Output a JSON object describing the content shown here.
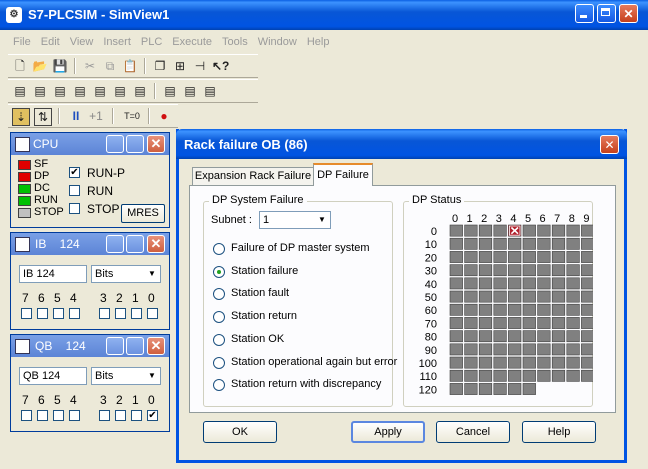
{
  "app": {
    "title": "S7-PLCSIM - SimView1",
    "menu": [
      "File",
      "Edit",
      "View",
      "Insert",
      "PLC",
      "Execute",
      "Tools",
      "Window",
      "Help"
    ],
    "toolbar3": {
      "pause": "II",
      "step": "+1",
      "timer_reset": "T=0"
    }
  },
  "cpu": {
    "title": "CPU",
    "leds": [
      {
        "label": "SF",
        "color": "#e00000"
      },
      {
        "label": "DP",
        "color": "#e00000"
      },
      {
        "label": "DC",
        "color": "#00c000"
      },
      {
        "label": "RUN",
        "color": "#00c000"
      },
      {
        "label": "STOP",
        "color": "#c0c0c0"
      }
    ],
    "modes": [
      {
        "label": "RUN-P",
        "checked": true
      },
      {
        "label": "RUN",
        "checked": false
      },
      {
        "label": "STOP",
        "checked": false
      }
    ],
    "mres_label": "MRES"
  },
  "ib": {
    "title": "IB    124",
    "address": "IB  124",
    "format": "Bits",
    "bit_labels": [
      "7",
      "6",
      "5",
      "4",
      "3",
      "2",
      "1",
      "0"
    ],
    "bits": [
      false,
      false,
      false,
      false,
      false,
      false,
      false,
      false
    ]
  },
  "qb": {
    "title": "QB    124",
    "address": "QB  124",
    "format": "Bits",
    "bit_labels": [
      "7",
      "6",
      "5",
      "4",
      "3",
      "2",
      "1",
      "0"
    ],
    "bits": [
      false,
      false,
      false,
      false,
      false,
      false,
      false,
      true
    ]
  },
  "dialog": {
    "title": "Rack failure OB (86)",
    "tabs": [
      {
        "label": "Expansion Rack Failure",
        "active": false
      },
      {
        "label": "DP Failure",
        "active": true
      }
    ],
    "system_group": "DP System Failure",
    "subnet_label": "Subnet :",
    "subnet_value": "1",
    "options": [
      {
        "label": "Failure of DP master system",
        "selected": false
      },
      {
        "label": "Station failure",
        "selected": true
      },
      {
        "label": "Station fault",
        "selected": false
      },
      {
        "label": "Station return",
        "selected": false
      },
      {
        "label": "Station OK",
        "selected": false
      },
      {
        "label": "Station operational again but error",
        "selected": false
      },
      {
        "label": "Station return with discrepancy",
        "selected": false
      }
    ],
    "status_group": "DP Status",
    "col_labels": [
      "0",
      "1",
      "2",
      "3",
      "4",
      "5",
      "6",
      "7",
      "8",
      "9"
    ],
    "row_labels": [
      "0",
      "10",
      "20",
      "30",
      "40",
      "50",
      "60",
      "70",
      "80",
      "90",
      "100",
      "110",
      "120"
    ],
    "last_row_cells": 6,
    "failed_station": 4,
    "buttons": {
      "ok": "OK",
      "apply": "Apply",
      "cancel": "Cancel",
      "help": "Help"
    }
  },
  "colors": {
    "accent": "#0054e3",
    "failed": "#b0202c",
    "desktop": "#ece9d8"
  }
}
